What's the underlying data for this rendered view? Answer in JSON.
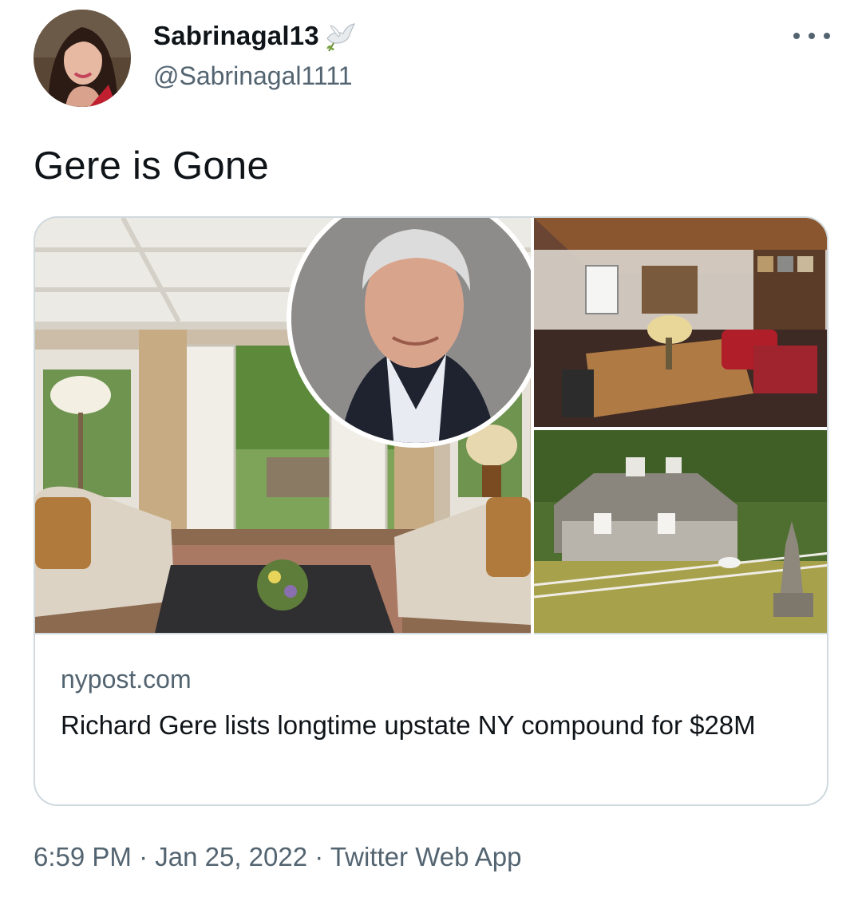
{
  "author": {
    "display_name": "Sabrinagal13",
    "handle": "@Sabrinagal1111",
    "avatar": "profile-photo",
    "name_emoji": "dove-with-olive-branch-icon"
  },
  "more_icon": "more-horizontal-icon",
  "tweet": {
    "text": "Gere is Gone"
  },
  "link_card": {
    "domain": "nypost.com",
    "title": "Richard Gere lists longtime upstate NY compound for $28M",
    "images": [
      "living-room-photo",
      "portrait-inset-photo",
      "study-room-photo",
      "barn-estate-photo"
    ]
  },
  "meta": {
    "time": "6:59 PM",
    "separator": "·",
    "date": "Jan 25, 2022",
    "source": "Twitter Web App"
  },
  "colors": {
    "text_primary": "#0f1419",
    "text_secondary": "#536471",
    "border": "#cfd9de"
  }
}
